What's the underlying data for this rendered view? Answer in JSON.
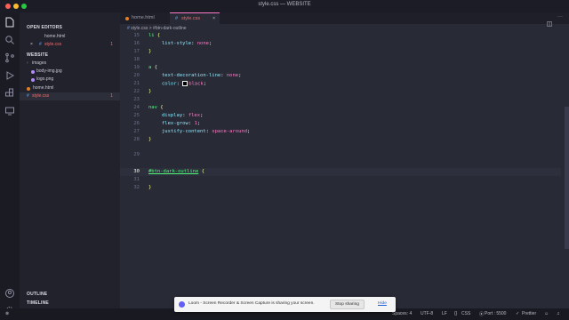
{
  "window": {
    "title": "style.css — WEBSITE"
  },
  "sidebar": {
    "open_editors_label": "OPEN EDITORS",
    "open_editors": [
      {
        "name": "home.html",
        "badge": ""
      },
      {
        "name": "style.css",
        "badge": "1"
      }
    ],
    "folder_label": "WEBSITE",
    "tree": [
      {
        "name": "images",
        "type": "folder",
        "badge": ""
      },
      {
        "name": "body-img.jpg",
        "type": "image",
        "badge": ""
      },
      {
        "name": "logo.png",
        "type": "image",
        "badge": ""
      },
      {
        "name": "home.html",
        "type": "html",
        "badge": ""
      },
      {
        "name": "style.css",
        "type": "css",
        "badge": "1"
      }
    ],
    "outline_label": "OUTLINE",
    "timeline_label": "TIMELINE"
  },
  "tabs": [
    {
      "label": "home.html",
      "active": false
    },
    {
      "label": "style.css",
      "active": true,
      "close": "×"
    }
  ],
  "breadcrumb": {
    "file": "style.css",
    "separator": ">",
    "symbol": "#btn-dark-outline"
  },
  "code": {
    "l15": {
      "num": "15",
      "selector": "li",
      "brace": " {"
    },
    "l16": {
      "num": "16",
      "prop": "list-style",
      "colon": ": ",
      "value": "none",
      "end": ";"
    },
    "l17": {
      "num": "17",
      "brace": "}"
    },
    "l18": {
      "num": "18"
    },
    "l19": {
      "num": "19",
      "selector": "a",
      "brace": " {"
    },
    "l20": {
      "num": "20",
      "prop": "text-decoration-line",
      "colon": ": ",
      "value": "none",
      "end": ";"
    },
    "l21": {
      "num": "21",
      "prop": "color",
      "colon": ": ",
      "value": "black",
      "end": ";"
    },
    "l22": {
      "num": "22",
      "brace": "}"
    },
    "l23": {
      "num": "23"
    },
    "l24": {
      "num": "24",
      "selector": "nav",
      "brace": " {"
    },
    "l25": {
      "num": "25",
      "prop": "display",
      "colon": ": ",
      "value": "flex",
      "end": ";"
    },
    "l26": {
      "num": "26",
      "prop": "flex-grow",
      "colon": ": ",
      "value": "1",
      "end": ";"
    },
    "l27": {
      "num": "27",
      "prop": "justify-content",
      "colon": ": ",
      "value": "space-around",
      "end": ";"
    },
    "l28": {
      "num": "28",
      "brace": "}"
    },
    "l29": {
      "num": "29"
    },
    "l30": {
      "num": "30",
      "selector": "#btn-dark-outline",
      "brace": " {"
    },
    "l31": {
      "num": "31"
    },
    "l32": {
      "num": "32",
      "brace": "}"
    }
  },
  "status": {
    "spaces": "Spaces: 4",
    "encoding": "UTF-8",
    "eol": "LF",
    "language": "CSS",
    "port": "Port : 5500",
    "formatter": "Prettier"
  },
  "loom": {
    "message": "Loom - Screen Recorder & Screen Capture is sharing your screen.",
    "stop": "Stop sharing",
    "hide": "Hide"
  },
  "colors": {
    "accent": "#ff79c6",
    "css_file": "#ff6b6b",
    "selector": "#50fa7b",
    "property": "#8be9fd"
  }
}
